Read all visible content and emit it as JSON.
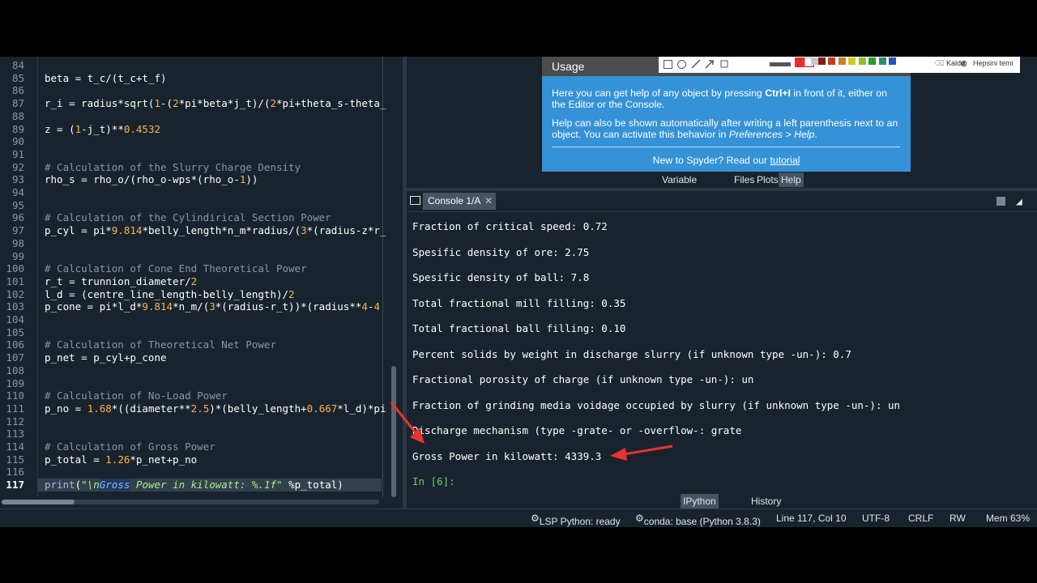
{
  "editor": {
    "lines": [
      {
        "n": "84",
        "t": ""
      },
      {
        "n": "85",
        "t": "beta = t_c/(t_c+t_f)"
      },
      {
        "n": "86",
        "t": ""
      },
      {
        "n": "87",
        "t": "r_i = radius*sqrt(1-(2*pi*beta*j_t)/(2*pi+theta_s-theta_"
      },
      {
        "n": "88",
        "t": ""
      },
      {
        "n": "89",
        "t": "z = (1-j_t)**0.4532"
      },
      {
        "n": "90",
        "t": ""
      },
      {
        "n": "91",
        "t": ""
      },
      {
        "n": "92",
        "t": "# Calculation of the Slurry Charge Density"
      },
      {
        "n": "93",
        "t": "rho_s = rho_o/(rho_o-wps*(rho_o-1))"
      },
      {
        "n": "94",
        "t": ""
      },
      {
        "n": "95",
        "t": ""
      },
      {
        "n": "96",
        "t": "# Calculation of the Cylindirical Section Power"
      },
      {
        "n": "97",
        "t": "p_cyl = pi*9.814*belly_length*n_m*radius/(3*(radius-z*r_"
      },
      {
        "n": "98",
        "t": ""
      },
      {
        "n": "99",
        "t": ""
      },
      {
        "n": "100",
        "t": "# Calculation of Cone End Theoretical Power"
      },
      {
        "n": "101",
        "t": "r_t = trunnion_diameter/2"
      },
      {
        "n": "102",
        "t": "l_d = (centre_line_length-belly_length)/2"
      },
      {
        "n": "103",
        "t": "p_cone = pi*l_d*9.814*n_m/(3*(radius-r_t))*(radius**4-4"
      },
      {
        "n": "104",
        "t": ""
      },
      {
        "n": "105",
        "t": ""
      },
      {
        "n": "106",
        "t": "# Calculation of Theoretical Net Power"
      },
      {
        "n": "107",
        "t": "p_net = p_cyl+p_cone"
      },
      {
        "n": "108",
        "t": ""
      },
      {
        "n": "109",
        "t": ""
      },
      {
        "n": "110",
        "t": "# Calculation of No-Load Power"
      },
      {
        "n": "111",
        "t": "p_no = 1.68*((diameter**2.5)*(belly_length+0.667*l_d)*pi"
      },
      {
        "n": "112",
        "t": ""
      },
      {
        "n": "113",
        "t": ""
      },
      {
        "n": "114",
        "t": "# Calculation of Gross Power"
      },
      {
        "n": "115",
        "t": "p_total = 1.26*p_net+p_no"
      },
      {
        "n": "116",
        "t": ""
      },
      {
        "n": "117",
        "t": "print(\"\\nGross Power in kilowatt: %.1f\" %p_total)"
      }
    ],
    "current_line": "117"
  },
  "help": {
    "title": "Usage",
    "p1_a": "Here you can get help of any object by pressing ",
    "p1_b": "Ctrl+I",
    "p1_c": " in front of it, either on the Editor or the Console.",
    "p2_a": "Help can also be shown automatically after writing a left parenthesis next to an object. You can activate this behavior in ",
    "p2_b": "Preferences > Help",
    "p2_c": ".",
    "new_a": "New to Spyder? Read our ",
    "new_link": "tutorial"
  },
  "annot_toolbar": {
    "remove_label": "Kaldır",
    "clear_label": "Hepsini temi",
    "colors": [
      "#ee2b2b",
      "#ffffff",
      "#c8c8c8",
      "#8b1a1a",
      "#c0392b",
      "#c0832b",
      "#d4c42b",
      "#8fbf2b",
      "#2b9b2b",
      "#2b8b6b",
      "#2b4fbf"
    ]
  },
  "top_tabs": [
    "Variable explorer",
    "Files",
    "Plots",
    "Help"
  ],
  "console": {
    "tab_label": "Console 1/A",
    "lines": [
      "Fraction of critical speed: 0.72",
      "Spesific density of ore: 2.75",
      "Spesific density of ball: 7.8",
      "Total fractional mill filling: 0.35",
      "Total fractional ball filling: 0.10",
      "Percent solids by weight in discharge slurry (if unknown type -un-): 0.7",
      "Fractional porosity of charge (if unknown type -un-): un",
      "Fraction of grinding media voidage occupied by slurry (if unknown type -un-): un",
      "Discharge mechanism (type -grate- or -overflow-: grate",
      "Gross Power in kilowatt: 4339.3"
    ],
    "prompt": "In [6]:"
  },
  "bottom_tabs": [
    "IPython console",
    "History"
  ],
  "status": {
    "lsp": "LSP Python: ready",
    "conda": "conda: base (Python 3.8.3)",
    "position": "Line 117, Col 10",
    "encoding": "UTF-8",
    "eol": "CRLF",
    "perm": "RW",
    "mem": "Mem 63%"
  },
  "colors": {
    "background": "#19232d",
    "help_blue": "#3592d7",
    "arrow_red": "#e8322e",
    "prompt_green": "#6cd26c"
  }
}
